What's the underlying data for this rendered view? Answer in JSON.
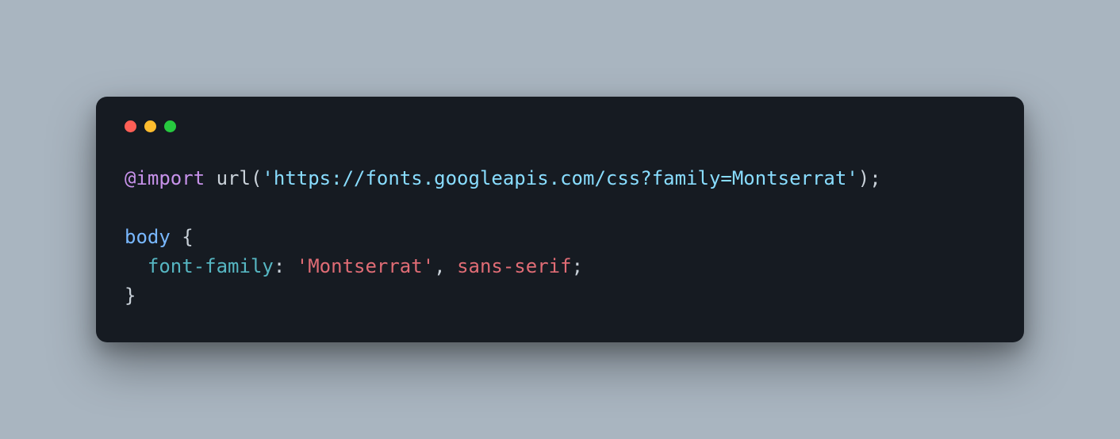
{
  "code": {
    "line1": {
      "at_import": "@import",
      "url_func": "url",
      "open_paren": "(",
      "url_string": "'https://fonts.googleapis.com/css?family=Montserrat'",
      "close_paren": ")",
      "semicolon": ";"
    },
    "blank_line": "",
    "line3": {
      "selector": "body",
      "open_brace": " {"
    },
    "line4": {
      "indent": "  ",
      "property": "font-family",
      "colon": ": ",
      "font_quoted": "'Montserrat'",
      "comma": ", ",
      "fallback": "sans-serif",
      "semicolon": ";"
    },
    "line5": {
      "close_brace": "}"
    }
  }
}
